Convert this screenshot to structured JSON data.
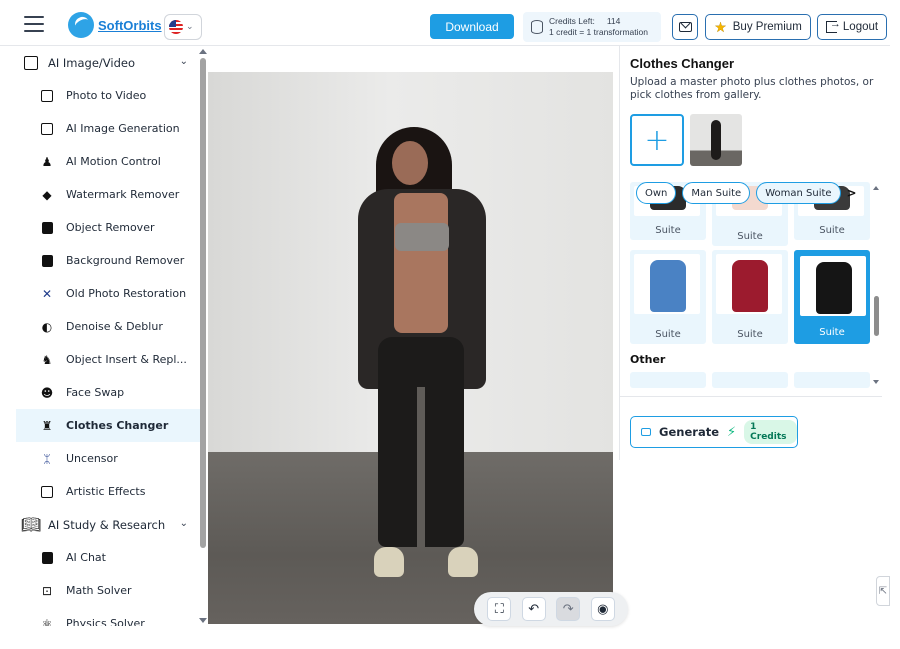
{
  "header": {
    "brand": "SoftOrbits",
    "download_label": "Download",
    "credits_label": "Credits Left:",
    "credits_value": "114",
    "credits_rate": "1 credit = 1 transformation",
    "premium_label": "Buy Premium",
    "logout_label": "Logout"
  },
  "sidebar": {
    "sections": [
      {
        "label": "AI Image/Video",
        "items": [
          {
            "label": "Photo to Video",
            "icon": "photo-video-icon"
          },
          {
            "label": "AI Image Generation",
            "icon": "image-generation-icon"
          },
          {
            "label": "AI Motion Control",
            "icon": "motion-control-icon"
          },
          {
            "label": "Watermark Remover",
            "icon": "eraser-icon"
          },
          {
            "label": "Object Remover",
            "icon": "object-remover-icon"
          },
          {
            "label": "Background Remover",
            "icon": "background-remover-icon"
          },
          {
            "label": "Old Photo Restoration",
            "icon": "restoration-icon"
          },
          {
            "label": "Denoise & Deblur",
            "icon": "denoise-icon"
          },
          {
            "label": "Object Insert & Repl...",
            "icon": "object-insert-icon"
          },
          {
            "label": "Face Swap",
            "icon": "face-swap-icon"
          },
          {
            "label": "Clothes Changer",
            "icon": "clothes-icon",
            "active": true
          },
          {
            "label": "Uncensor",
            "icon": "uncensor-icon"
          },
          {
            "label": "Artistic Effects",
            "icon": "artistic-effects-icon"
          }
        ]
      },
      {
        "label": "AI Study & Research",
        "items": [
          {
            "label": "AI Chat",
            "icon": "chat-icon"
          },
          {
            "label": "Math Solver",
            "icon": "math-solver-icon"
          },
          {
            "label": "Physics Solver",
            "icon": "physics-solver-icon"
          }
        ]
      }
    ]
  },
  "panel": {
    "title": "Clothes Changer",
    "description": "Upload a master photo plus clothes photos, or pick clothes from gallery.",
    "add_symbol": "+",
    "categories": [
      "Own",
      "Man Suite",
      "Woman Suite"
    ],
    "active_category": "Woman Suite",
    "next_symbol": ">",
    "gallery_row1": [
      "Suite",
      "Suite",
      "Suite"
    ],
    "gallery_row2": [
      "Suite",
      "Suite",
      "Suite"
    ],
    "other_label": "Other",
    "generate_label": "Generate",
    "generate_cost": "1 Credits"
  },
  "colors": {
    "accent": "#1e9de3",
    "active_bg": "#eaf6fd",
    "credit_green": "#10b981"
  }
}
